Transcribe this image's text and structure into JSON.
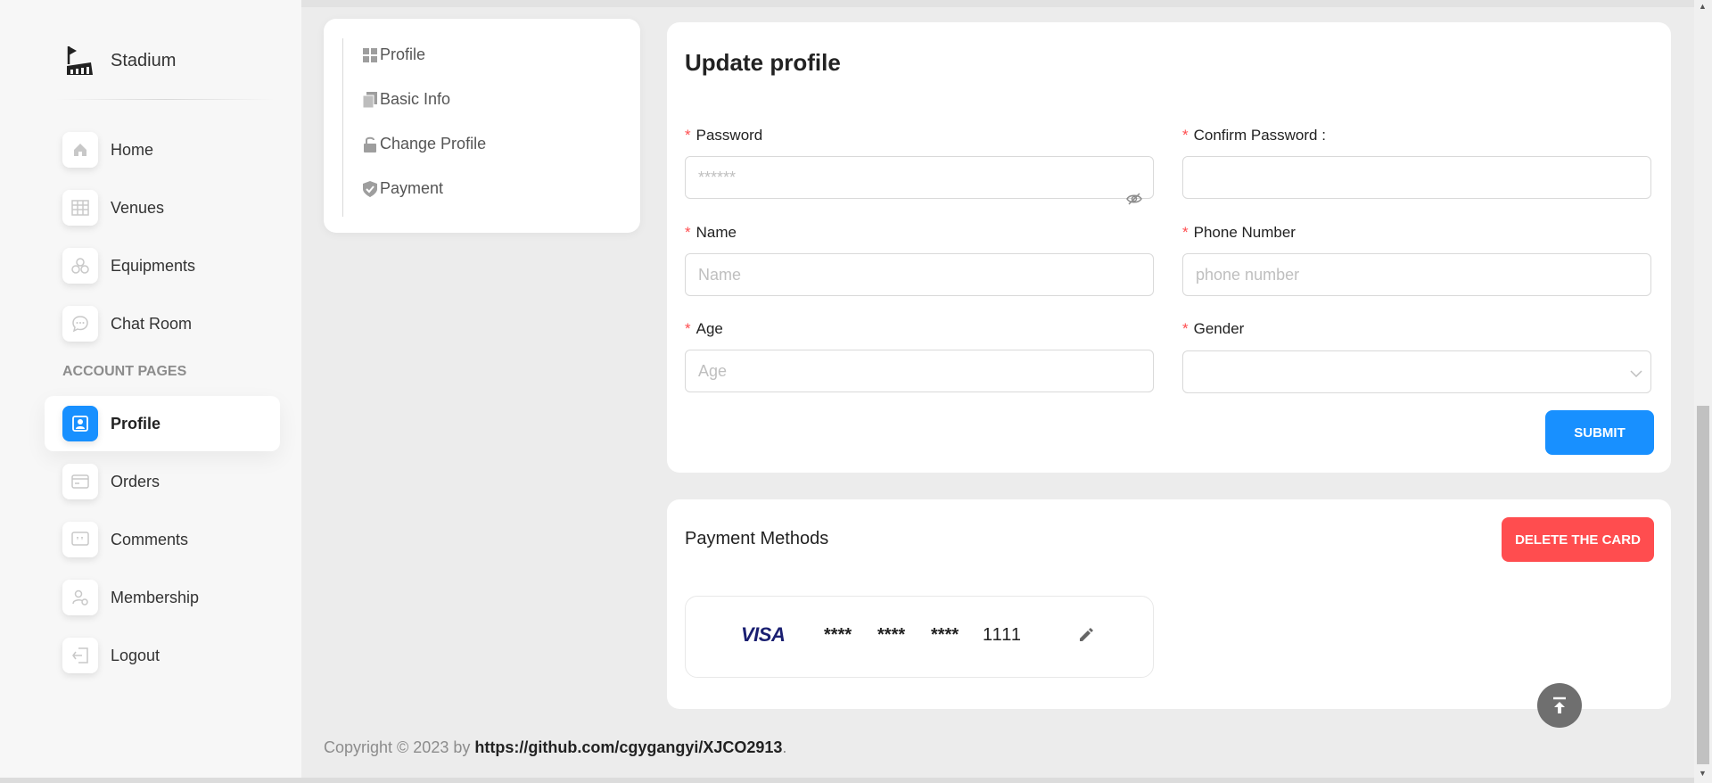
{
  "sidebar": {
    "brand": "Stadium",
    "section_title": "ACCOUNT PAGES",
    "items": [
      {
        "label": "Home",
        "icon": "home-icon"
      },
      {
        "label": "Venues",
        "icon": "table-icon"
      },
      {
        "label": "Equipments",
        "icon": "cubes-icon"
      },
      {
        "label": "Chat Room",
        "icon": "chat-icon"
      },
      {
        "label": "Profile",
        "icon": "profile-icon",
        "active": true
      },
      {
        "label": "Orders",
        "icon": "credit-card-icon"
      },
      {
        "label": "Comments",
        "icon": "quote-icon"
      },
      {
        "label": "Membership",
        "icon": "user-settings-icon"
      },
      {
        "label": "Logout",
        "icon": "logout-icon"
      }
    ]
  },
  "submenu": {
    "items": [
      {
        "label": "Profile",
        "icon": "grid-icon"
      },
      {
        "label": "Basic Info",
        "icon": "copy-icon"
      },
      {
        "label": "Change Profile",
        "icon": "unlock-icon"
      },
      {
        "label": "Payment",
        "icon": "shield-icon"
      }
    ]
  },
  "update_profile": {
    "title": "Update profile",
    "password": {
      "label": "Password",
      "placeholder": "******"
    },
    "confirm_password": {
      "label": "Confirm Password :",
      "placeholder": ""
    },
    "name": {
      "label": "Name",
      "placeholder": "Name"
    },
    "phone": {
      "label": "Phone Number",
      "placeholder": "phone number"
    },
    "age": {
      "label": "Age",
      "placeholder": "Age"
    },
    "gender": {
      "label": "Gender",
      "value": ""
    },
    "submit_label": "SUBMIT"
  },
  "payment": {
    "title": "Payment Methods",
    "delete_label": "DELETE THE CARD",
    "card": {
      "brand": "VISA",
      "group1": "****",
      "group2": "****",
      "group3": "****",
      "last4": "1111"
    }
  },
  "footer": {
    "prefix": "Copyright © 2023 by ",
    "link": "https://github.com/cgygangyi/XJCO2913",
    "suffix": "."
  },
  "colors": {
    "primary": "#1890ff",
    "danger": "#ff4d4f",
    "required": "#ff4d4f"
  }
}
